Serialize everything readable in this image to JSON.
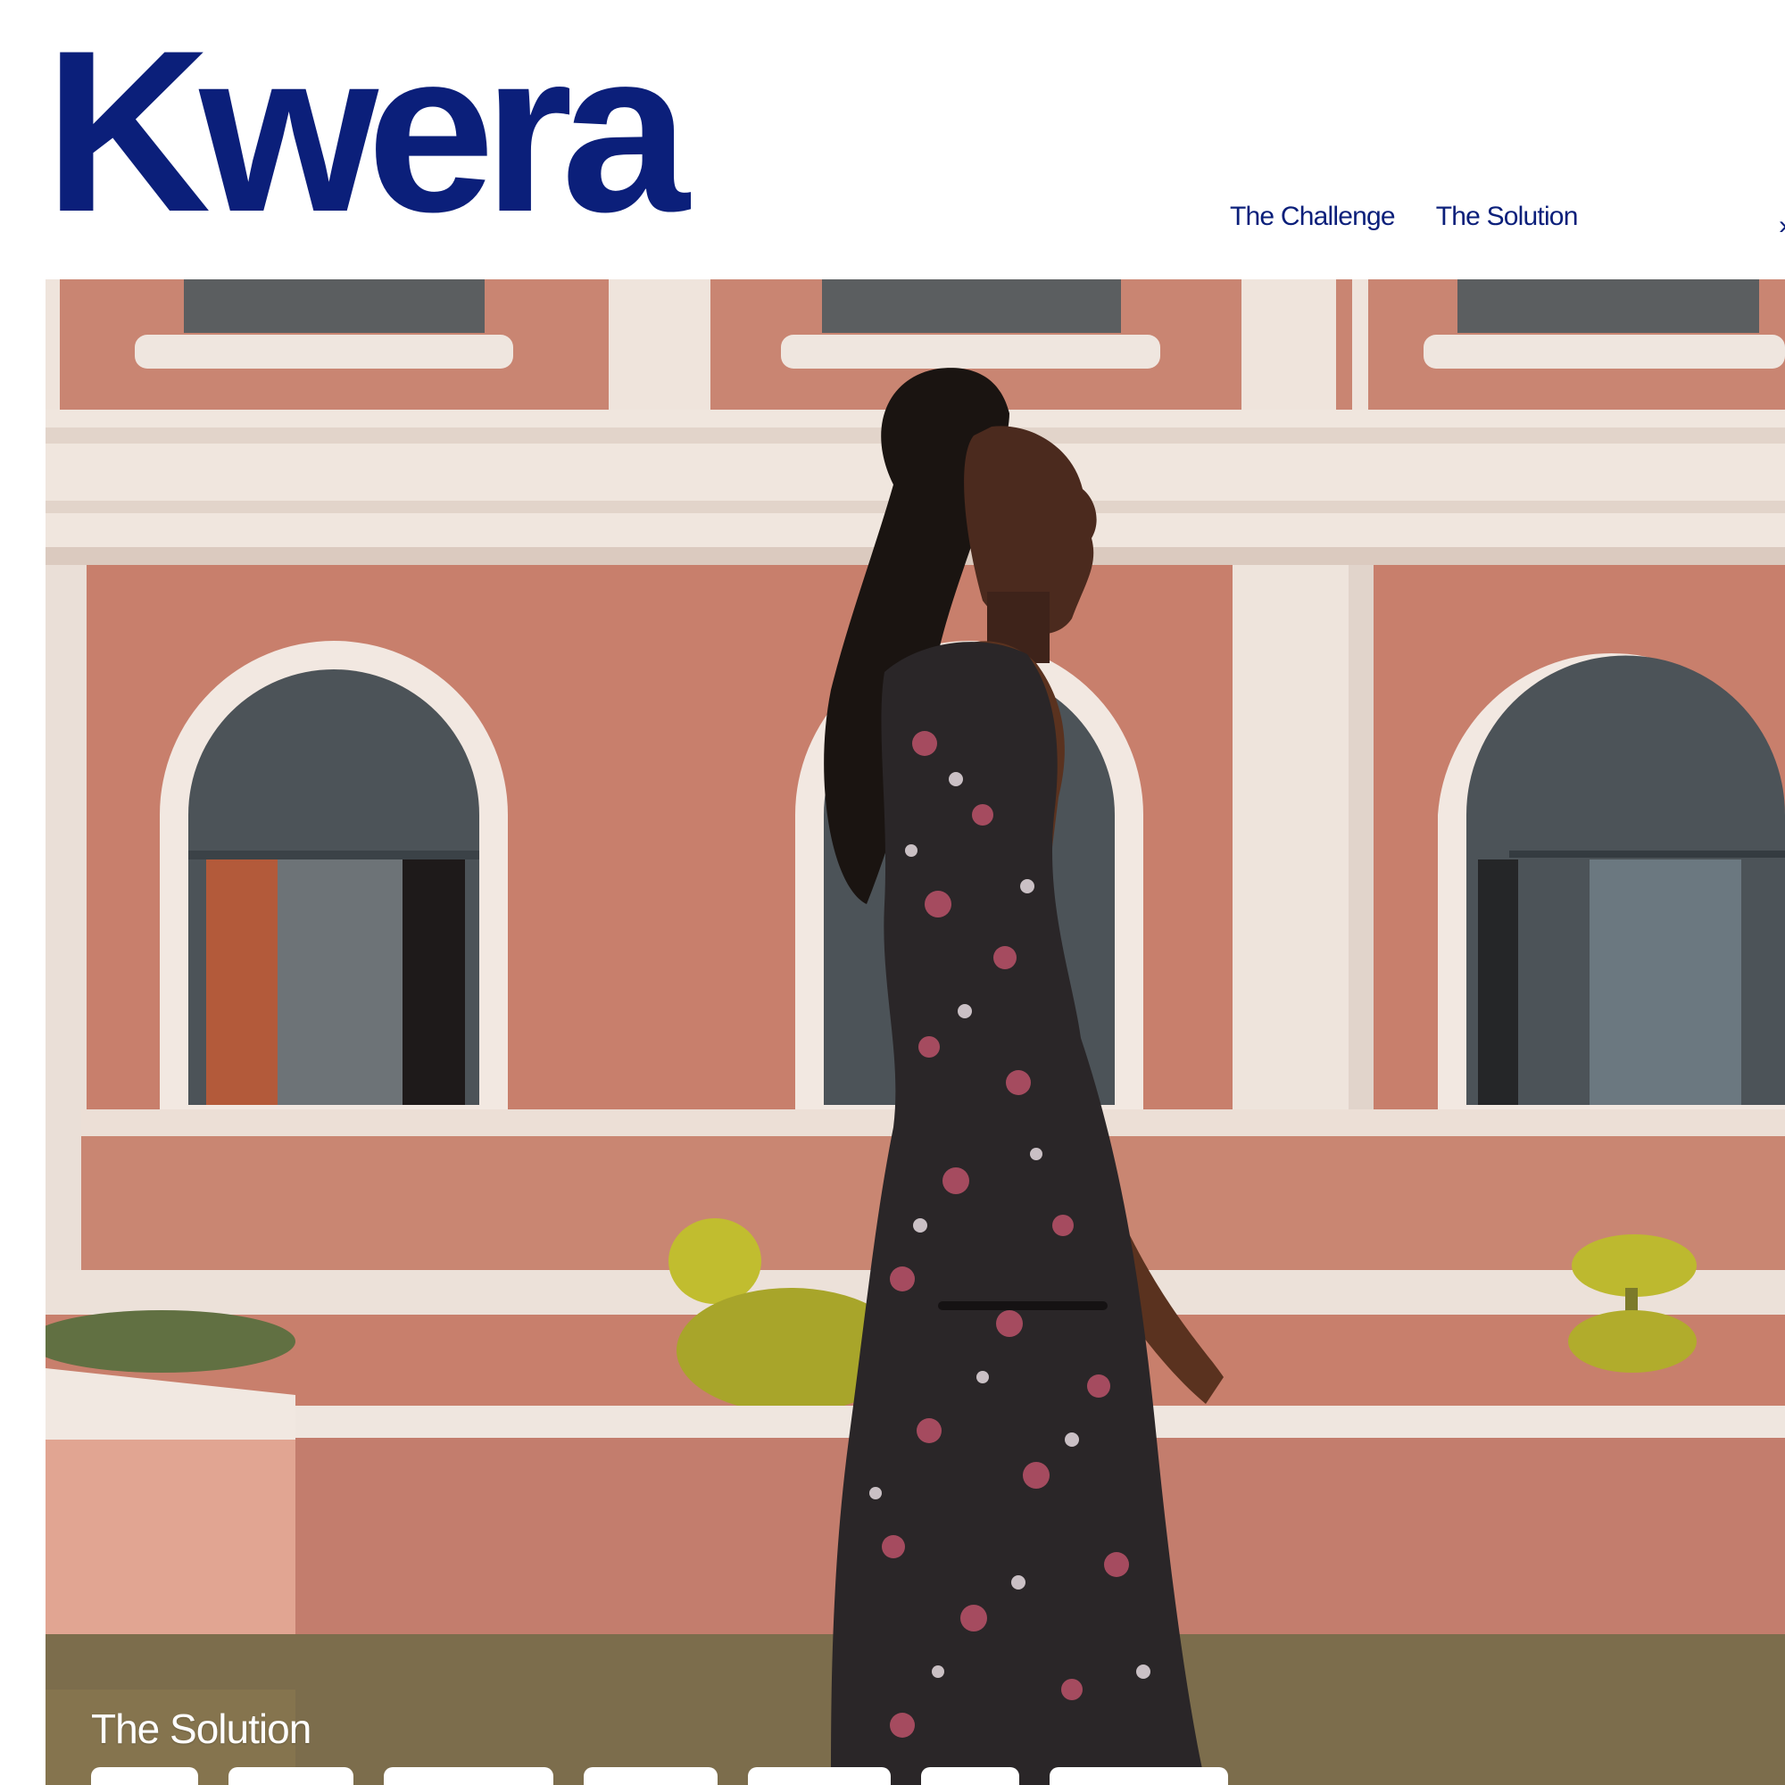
{
  "brand": {
    "logo_text": "Kwera",
    "color": "#0b1f7a"
  },
  "nav": {
    "items": [
      {
        "label": "The Challenge"
      },
      {
        "label": "The Solution"
      }
    ]
  },
  "hero": {
    "section_label": "The Solution",
    "image_subject": "Young woman in a floral sleeveless dress walking past a pink brick building with arched windows and white trim",
    "palette": {
      "wall": "#c37a67",
      "trim": "#efe4dc",
      "window": "#4c5358",
      "foliage": "#b5b22c",
      "ground": "#6b6849"
    }
  }
}
